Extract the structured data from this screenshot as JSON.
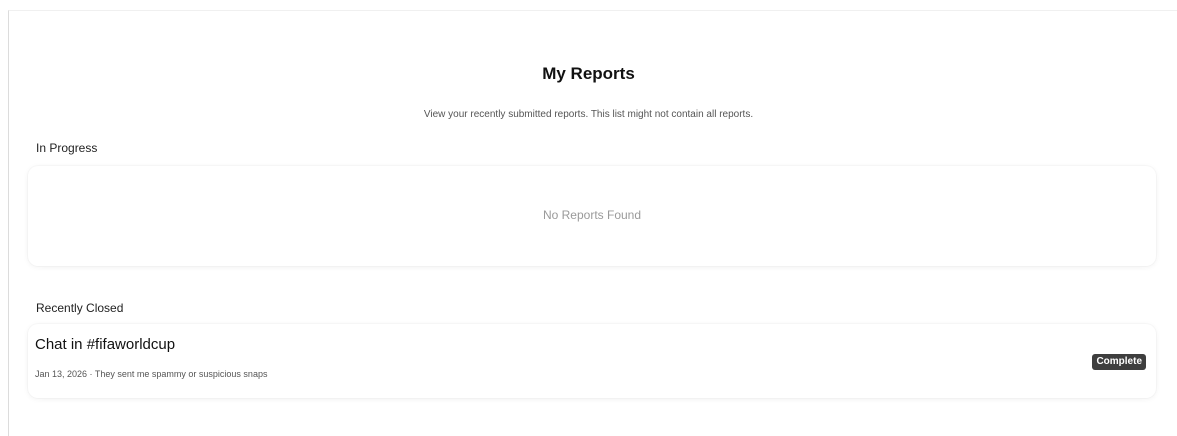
{
  "header": {
    "title": "My Reports",
    "subtitle": "View your recently submitted reports. This list might not contain all reports."
  },
  "in_progress": {
    "label": "In Progress",
    "empty_text": "No Reports Found"
  },
  "recently_closed": {
    "label": "Recently Closed",
    "items": [
      {
        "title": "Chat in #fifaworldcup",
        "meta": "Jan 13, 2026 · They sent me spammy or suspicious snaps",
        "status": "Complete"
      }
    ]
  },
  "colors": {
    "badge_bg": "#3e3e3e",
    "muted_text": "#9a9a9a"
  }
}
